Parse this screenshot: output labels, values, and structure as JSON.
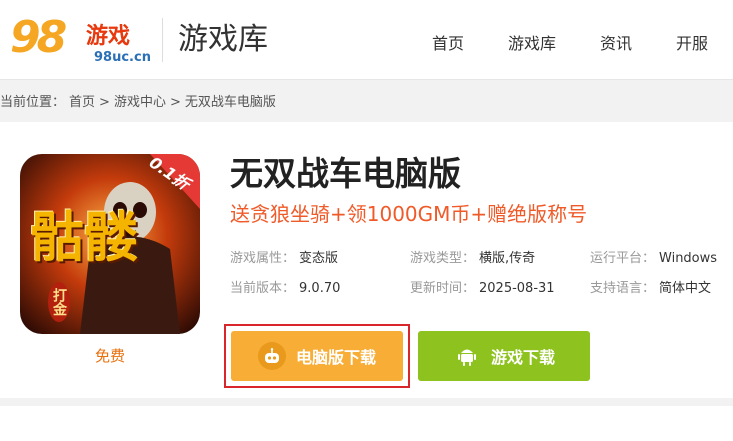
{
  "logo": {
    "number": "98",
    "brand": "游戏",
    "domain": "98uc.cn"
  },
  "header": {
    "section_title": "游戏库"
  },
  "nav": [
    {
      "label": "首页"
    },
    {
      "label": "游戏库"
    },
    {
      "label": "资讯"
    },
    {
      "label": "开服"
    }
  ],
  "breadcrumb": {
    "prefix": "当前位置：",
    "items": [
      "首页",
      "游戏中心",
      "无双战车电脑版"
    ],
    "separator": ">"
  },
  "app": {
    "title": "无双战车电脑版",
    "promo": "送贪狼坐骑+领1000GM币+赠绝版称号",
    "price_label": "免费",
    "icon_text": {
      "badge": "0.1折",
      "main": "骷髅",
      "sub": "打金"
    },
    "info": [
      {
        "key": "游戏属性：",
        "value": "变态版"
      },
      {
        "key": "游戏类型：",
        "value": "横版,传奇"
      },
      {
        "key": "运行平台：",
        "value": "Windows"
      },
      {
        "key": "当前版本：",
        "value": "9.0.70"
      },
      {
        "key": "更新时间：",
        "value": "2025-08-31"
      },
      {
        "key": "支持语言：",
        "value": "简体中文"
      }
    ]
  },
  "buttons": {
    "pc_download": "电脑版下载",
    "game_download": "游戏下载"
  },
  "colors": {
    "pc_button": "#f7ad36",
    "game_button": "#8dc21f",
    "promo": "#f05a28",
    "highlight_border": "#d9262c"
  }
}
